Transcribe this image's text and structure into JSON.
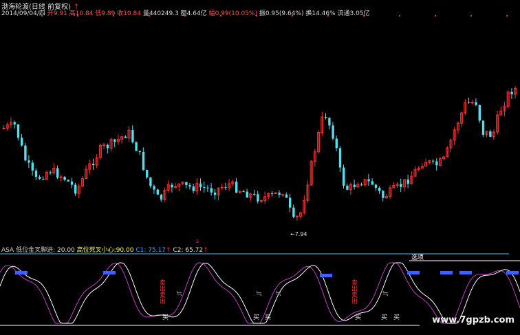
{
  "header": {
    "title": "渤海轮渡(日线 前复权)",
    "arrow": "↑",
    "quote": [
      {
        "text": "2014/09/04/四",
        "cls": "w"
      },
      {
        "text": " 开9.91",
        "cls": "r"
      },
      {
        "text": " 高10.84",
        "cls": "r"
      },
      {
        "text": " 低9.89",
        "cls": "r"
      },
      {
        "text": " 收10.84",
        "cls": "r"
      },
      {
        "text": " 量440249.3",
        "cls": "w"
      },
      {
        "text": " 额4.64亿",
        "cls": "w"
      },
      {
        "text": " 幅0.99(10.05%)",
        "cls": "r"
      },
      {
        "text": "      振0.95(9.64%)",
        "cls": "w"
      },
      {
        "text": " 换14.46%",
        "cls": "w"
      },
      {
        "text": " 流通3.05亿",
        "cls": "w"
      }
    ]
  },
  "chart": {
    "low_label": "←7.94",
    "up_color": "#ff3030",
    "down_color": "#50e0f0"
  },
  "indicator": {
    "name": "ASA",
    "p1_label": "低位金叉脚进:",
    "p1_value": "20.00",
    "p2_label": "高位死叉小心:",
    "p2_value": "90.00",
    "c1_label": "C1:",
    "c1_value": "75.17",
    "c2_label": "C2:",
    "c2_value": "65.72",
    "arrow": "↑",
    "select_label": "选项",
    "buy_text": "买",
    "sell_text": "卖",
    "sell_stack": "卖出卖出",
    "line1_color": "#ffffff",
    "line2_color": "#c040c0"
  },
  "watermark": "www.7gpzb.com"
}
